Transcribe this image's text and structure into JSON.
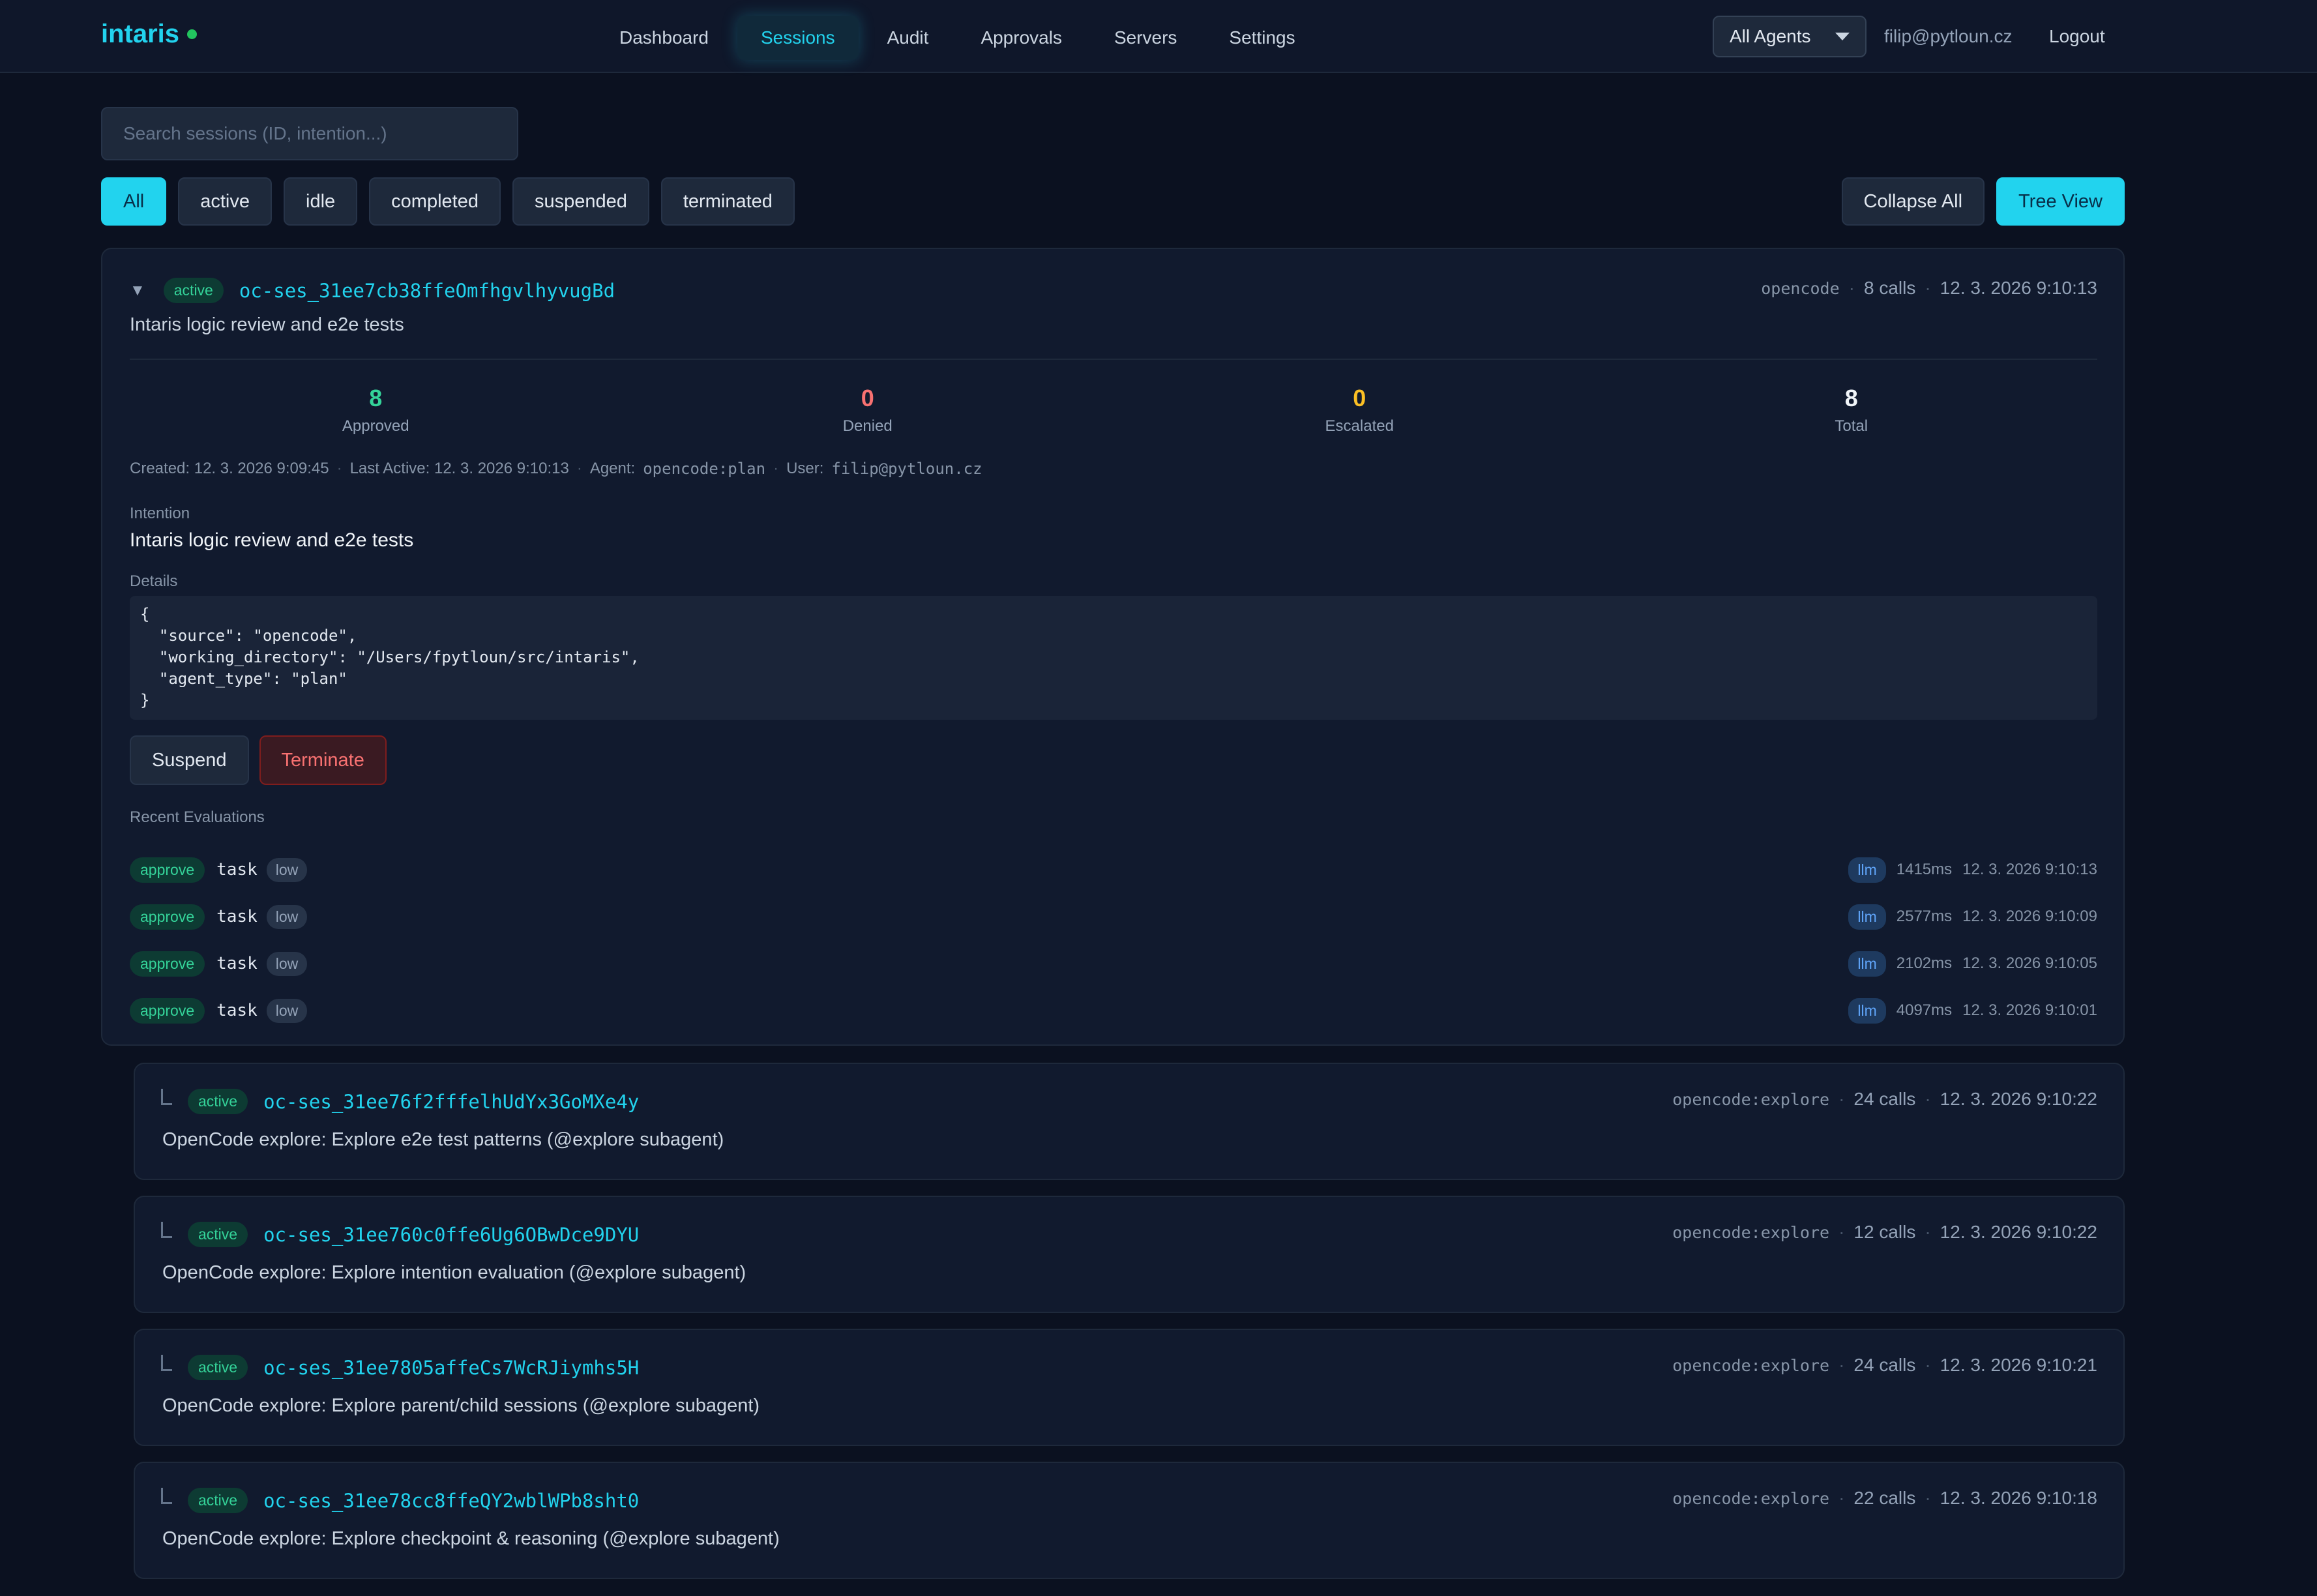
{
  "header": {
    "logo": "intaris",
    "nav": [
      "Dashboard",
      "Sessions",
      "Audit",
      "Approvals",
      "Servers",
      "Settings"
    ],
    "active_nav": "Sessions",
    "agent_select": "All Agents",
    "user_email": "filip@pytloun.cz",
    "logout": "Logout"
  },
  "toolbar": {
    "search_placeholder": "Search sessions (ID, intention...)",
    "filters": [
      "All",
      "active",
      "idle",
      "completed",
      "suspended",
      "terminated"
    ],
    "active_filter": "All",
    "collapse_all": "Collapse All",
    "tree_view": "Tree View"
  },
  "session": {
    "toggle": "▼",
    "status": "active",
    "id": "oc-ses_31ee7cb38ffeOmfhgvlhyvugBd",
    "agent": "opencode",
    "calls": "8 calls",
    "timestamp": "12. 3. 2026 9:10:13",
    "intention_line": "Intaris logic review and e2e tests",
    "stats": [
      {
        "value": "8",
        "label": "Approved",
        "color": "#34d399"
      },
      {
        "value": "0",
        "label": "Denied",
        "color": "#f87171"
      },
      {
        "value": "0",
        "label": "Escalated",
        "color": "#fbbf24"
      },
      {
        "value": "8",
        "label": "Total",
        "color": "#f1f5f9"
      }
    ],
    "created": "Created: 12. 3. 2026 9:09:45",
    "last_active": "Last Active: 12. 3. 2026 9:10:13",
    "agent_label": "Agent:",
    "agent_value": "opencode:plan",
    "user_label": "User:",
    "user_value": "filip@pytloun.cz",
    "intention_label": "Intention",
    "intention": "Intaris logic review and e2e tests",
    "details_label": "Details",
    "details_json": "{\n  \"source\": \"opencode\",\n  \"working_directory\": \"/Users/fpytloun/src/intaris\",\n  \"agent_type\": \"plan\"\n}",
    "suspend": "Suspend",
    "terminate": "Terminate",
    "recent_label": "Recent Evaluations",
    "evaluations": [
      {
        "decision": "approve",
        "tool": "task",
        "risk": "low",
        "evaluator": "llm",
        "latency": "1415ms",
        "time": "12. 3. 2026 9:10:13"
      },
      {
        "decision": "approve",
        "tool": "task",
        "risk": "low",
        "evaluator": "llm",
        "latency": "2577ms",
        "time": "12. 3. 2026 9:10:09"
      },
      {
        "decision": "approve",
        "tool": "task",
        "risk": "low",
        "evaluator": "llm",
        "latency": "2102ms",
        "time": "12. 3. 2026 9:10:05"
      },
      {
        "decision": "approve",
        "tool": "task",
        "risk": "low",
        "evaluator": "llm",
        "latency": "4097ms",
        "time": "12. 3. 2026 9:10:01"
      }
    ]
  },
  "children": [
    {
      "status": "active",
      "id": "oc-ses_31ee76f2fffelhUdYx3GoMXe4y",
      "agent": "opencode:explore",
      "calls": "24 calls",
      "time": "12. 3. 2026 9:10:22",
      "desc": "OpenCode explore: Explore e2e test patterns (@explore subagent)"
    },
    {
      "status": "active",
      "id": "oc-ses_31ee760c0ffe6Ug6OBwDce9DYU",
      "agent": "opencode:explore",
      "calls": "12 calls",
      "time": "12. 3. 2026 9:10:22",
      "desc": "OpenCode explore: Explore intention evaluation (@explore subagent)"
    },
    {
      "status": "active",
      "id": "oc-ses_31ee7805affeCs7WcRJiymhs5H",
      "agent": "opencode:explore",
      "calls": "24 calls",
      "time": "12. 3. 2026 9:10:21",
      "desc": "OpenCode explore: Explore parent/child sessions (@explore subagent)"
    },
    {
      "status": "active",
      "id": "oc-ses_31ee78cc8ffeQY2wblWPb8sht0",
      "agent": "opencode:explore",
      "calls": "22 calls",
      "time": "12. 3. 2026 9:10:18",
      "desc": "OpenCode explore: Explore checkpoint & reasoning (@explore subagent)"
    }
  ]
}
